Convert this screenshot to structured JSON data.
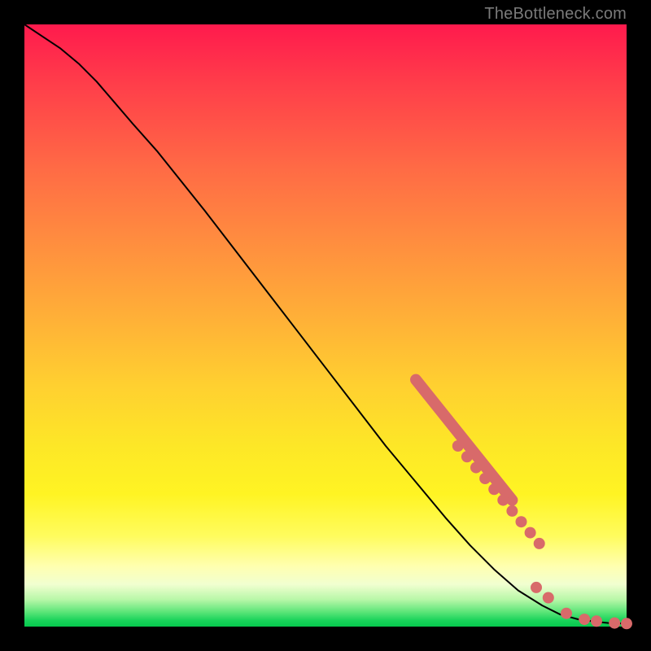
{
  "watermark": "TheBottleneck.com",
  "chart_data": {
    "type": "line",
    "title": "",
    "xlabel": "",
    "ylabel": "",
    "xlim": [
      0,
      100
    ],
    "ylim": [
      0,
      100
    ],
    "grid": false,
    "legend": false,
    "series": [
      {
        "name": "curve",
        "style": "line",
        "color": "#000000",
        "x": [
          0,
          3,
          6,
          9,
          12,
          15,
          18,
          22,
          26,
          30,
          35,
          40,
          45,
          50,
          55,
          60,
          65,
          70,
          74,
          78,
          82,
          86,
          89,
          92,
          95,
          97,
          100
        ],
        "y": [
          100,
          98,
          96,
          93.5,
          90.5,
          87,
          83.5,
          79,
          74,
          69,
          62.5,
          56,
          49.5,
          43,
          36.5,
          30,
          24,
          18,
          13.5,
          9.5,
          6,
          3.5,
          2,
          1.2,
          0.8,
          0.6,
          0.5
        ]
      },
      {
        "name": "highlight-segment-upper",
        "style": "thick-line",
        "color": "#d86a6a",
        "x": [
          65,
          67,
          69,
          71,
          73,
          75,
          77,
          79,
          81
        ],
        "y": [
          41,
          38.5,
          36,
          33.5,
          31,
          28.5,
          26,
          23.5,
          21
        ]
      },
      {
        "name": "highlight-dots-mid",
        "style": "dots",
        "color": "#d86a6a",
        "x": [
          72,
          73.5,
          75,
          76.5,
          78,
          79.5,
          81,
          82.5,
          84,
          85.5
        ],
        "y": [
          30,
          28.2,
          26.4,
          24.6,
          22.8,
          21,
          19.2,
          17.4,
          15.6,
          13.8
        ]
      },
      {
        "name": "highlight-dots-lower",
        "style": "dots",
        "color": "#d86a6a",
        "x": [
          85,
          87,
          90,
          93,
          95,
          98,
          100
        ],
        "y": [
          6.5,
          4.8,
          2.2,
          1.2,
          0.9,
          0.6,
          0.5
        ]
      }
    ]
  }
}
